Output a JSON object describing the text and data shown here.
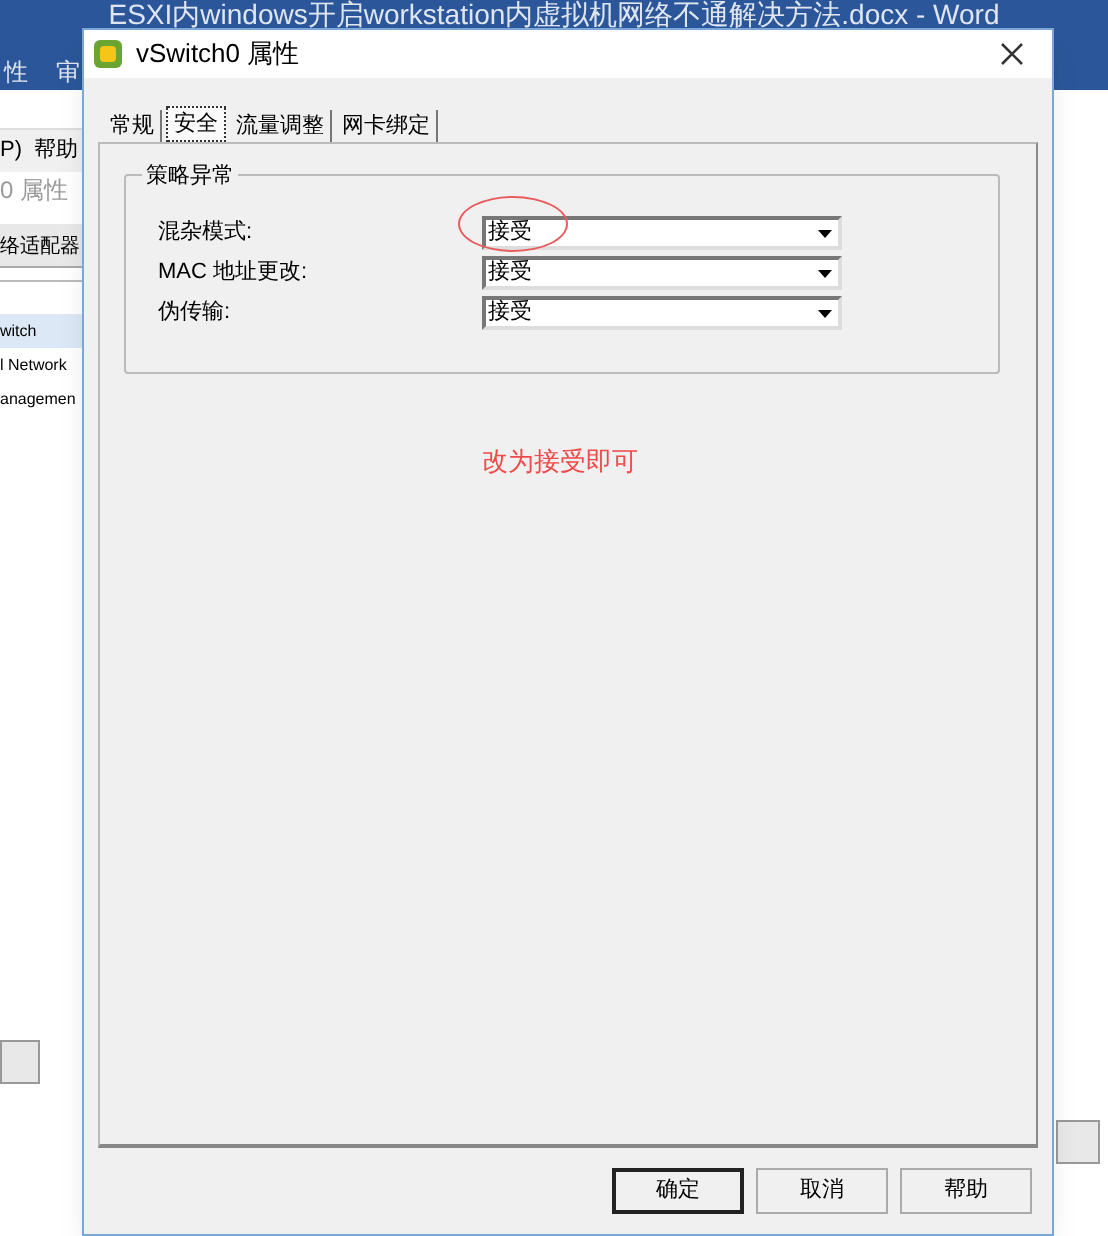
{
  "background_window": {
    "title": "ESXI内windows开启workstation内虚拟机网络不通解决方法.docx  -  Word",
    "ribbon_tabs": [
      "性",
      "审"
    ],
    "menu_items": [
      "P)",
      "帮助"
    ],
    "panel_title": "0 属性",
    "tab": "络适配器",
    "list_items": [
      {
        "label": "witch",
        "selected": true
      },
      {
        "label": "l Network",
        "selected": false
      },
      {
        "label": "anagemen",
        "selected": false
      }
    ]
  },
  "dialog": {
    "title": "vSwitch0 属性",
    "tabs": [
      {
        "label": "常规",
        "selected": false
      },
      {
        "label": "安全",
        "selected": true
      },
      {
        "label": "流量调整",
        "selected": false
      },
      {
        "label": "网卡绑定",
        "selected": false
      }
    ],
    "group_title": "策略异常",
    "settings": [
      {
        "label": "混杂模式:",
        "value": "接受",
        "highlighted": true
      },
      {
        "label": "MAC 地址更改:",
        "value": "接受",
        "highlighted": false
      },
      {
        "label": "伪传输:",
        "value": "接受",
        "highlighted": false
      }
    ],
    "note": "改为接受即可",
    "buttons": [
      {
        "label": "确定",
        "default": true
      },
      {
        "label": "取消",
        "default": false
      },
      {
        "label": "帮助",
        "default": false
      }
    ]
  }
}
